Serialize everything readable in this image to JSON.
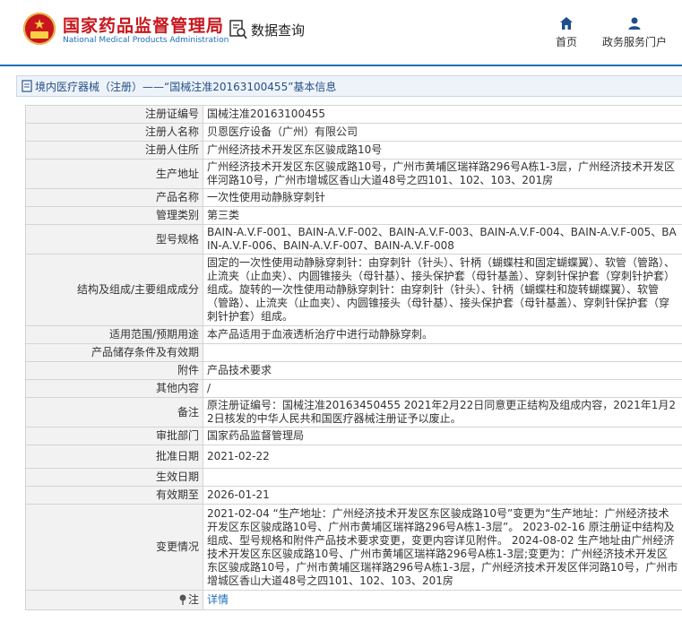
{
  "header": {
    "brand_cn": "国家药品监督管理局",
    "brand_en": "National Medical Products Administration",
    "query_label": "数据查询",
    "nav": [
      {
        "label": "首页",
        "icon": "home-icon"
      },
      {
        "label": "政务服务门户",
        "icon": "user-icon"
      }
    ],
    "accent": "#1e6fba",
    "brand_color": "#c8161d"
  },
  "breadcrumb": {
    "text": "境内医疗器械（注册）——“国械注准20163100455”基本信息"
  },
  "rows": [
    {
      "label": "注册证编号",
      "value": "国械注准20163100455"
    },
    {
      "label": "注册人名称",
      "value": "贝恩医疗设备（广州）有限公司"
    },
    {
      "label": "注册人住所",
      "value": "广州经济技术开发区东区骏成路10号"
    },
    {
      "label": "生产地址",
      "value": "广州经济技术开发区东区骏成路10号，广州市黄埔区瑞祥路296号A栋1-3层，广州经济技术开发区伴河路10号，广州市增城区香山大道48号之四101、102、103、201房"
    },
    {
      "label": "产品名称",
      "value": "一次性使用动静脉穿刺针"
    },
    {
      "label": "管理类别",
      "value": "第三类"
    },
    {
      "label": "型号规格",
      "value": "BAIN-A.V.F-001、BAIN-A.V.F-002、BAIN-A.V.F-003、BAIN-A.V.F-004、BAIN-A.V.F-005、BAIN-A.V.F-006、BAIN-A.V.F-007、BAIN-A.V.F-008"
    },
    {
      "label": "结构及组成/主要组成成分",
      "value": "固定的一次性使用动静脉穿刺针：由穿刺针（针头）、针柄（蝴蝶柱和固定蝴蝶翼）、软管（管路）、止流夹（止血夹）、内圆锥接头（母针基）、接头保护套（母针基盖）、穿刺针保护套（穿刺针护套）组成。旋转的一次性使用动静脉穿刺针：由穿刺针（针头）、针柄（蝴蝶柱和旋转蝴蝶翼）、软管（管路）、止流夹（止血夹）、内圆锥接头（母针基）、接头保护套（母针基盖）、穿刺针保护套（穿刺针护套）组成。"
    },
    {
      "label": "适用范围/预期用途",
      "value": "本产品适用于血液透析治疗中进行动静脉穿刺。"
    },
    {
      "label": "产品储存条件及有效期",
      "value": ""
    },
    {
      "label": "附件",
      "value": "产品技术要求"
    },
    {
      "label": "其他内容",
      "value": "/"
    },
    {
      "label": "备注",
      "value": "原注册证编号：国械注准20163450455 2021年2月22日同意更正结构及组成内容，2021年1月22日核发的中华人民共和国医疗器械注册证予以废止。"
    },
    {
      "label": "审批部门",
      "value": "国家药品监督管理局"
    },
    {
      "label": "批准日期",
      "value": "2021-02-22"
    },
    {
      "label": "生效日期",
      "value": ""
    },
    {
      "label": "有效期至",
      "value": "2026-01-21"
    },
    {
      "label": "变更情况",
      "value": "2021-02-04 “生产地址：广州经济技术开发区东区骏成路10号”变更为“生产地址：广州经济技术开发区东区骏成路10号、广州市黄埔区瑞祥路296号A栋1-3层”。 2023-02-16 原注册证中结构及组成、型号规格和附件产品技术要求变更，变更内容详见附件。 2024-08-02 生产地址由广州经济技术开发区东区骏成路10号、广州市黄埔区瑞祥路296号A栋1-3层;变更为：广州经济技术开发区东区骏成路10号，广州市黄埔区瑞祥路296号A栋1-3层，广州经济技术开发区伴河路10号，广州市增城区香山大道48号之四101、102、103、201房"
    }
  ],
  "note_row": {
    "label": "注",
    "value": "详情"
  }
}
